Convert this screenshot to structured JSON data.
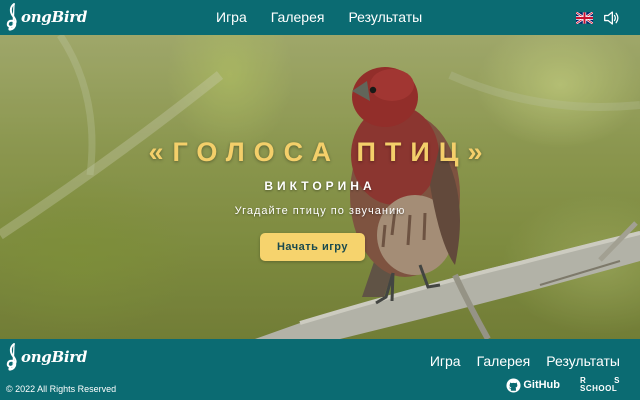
{
  "header": {
    "logo_text": "ongBird",
    "nav": {
      "game": "Игра",
      "gallery": "Галерея",
      "results": "Результаты"
    },
    "language_icon": "uk-flag-icon",
    "sound_icon": "speaker-icon"
  },
  "hero": {
    "title": "«ГОЛОСА ПТИЦ»",
    "subtitle": "ВИКТОРИНА",
    "description": "Угадайте птицу по звучанию",
    "start_button": "Начать игру"
  },
  "footer": {
    "logo_text": "ongBird",
    "nav": {
      "game": "Игра",
      "gallery": "Галерея",
      "results": "Результаты"
    },
    "copyright": "© 2022 All Rights Reserved",
    "github_label": "GitHub",
    "rs_school": {
      "r": "R",
      "s": "S",
      "school": "SCHOOL"
    }
  },
  "colors": {
    "primary": "#0b6b72",
    "accent": "#f4cf6a",
    "button": "#f6d36d"
  }
}
